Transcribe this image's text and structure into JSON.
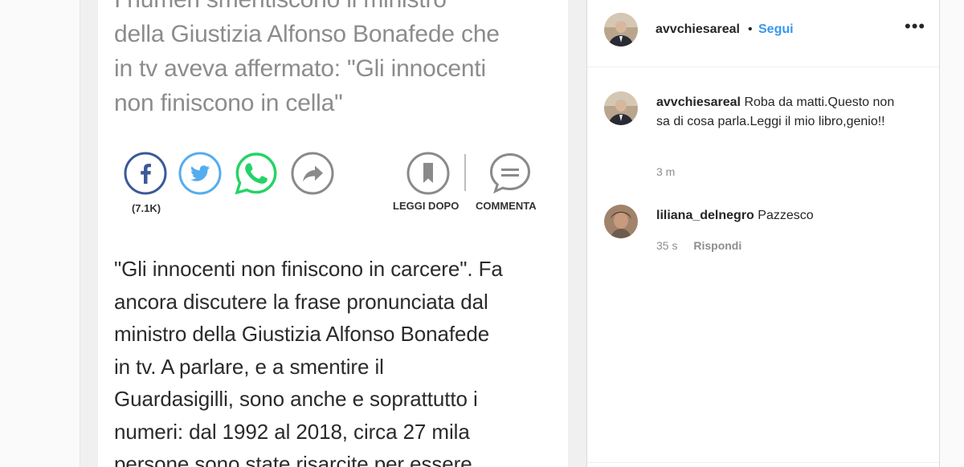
{
  "article": {
    "lead_line_1": "I numeri smentiscono il ministro",
    "lead_line_2": "della Giustizia Alfonso Bonafede che",
    "lead_line_3": "in tv aveva affermato: \"Gli innocenti",
    "lead_line_4": "non finiscono in cella\"",
    "share": {
      "facebook_count": "(7.1K)",
      "read_later_label": "LEGGI DOPO",
      "comment_label": "COMMENTA",
      "icons": [
        "facebook-icon",
        "twitter-icon",
        "whatsapp-icon",
        "share-icon",
        "bookmark-icon",
        "comment-icon"
      ]
    },
    "body_lines": [
      "\"Gli innocenti non finiscono in carcere\". Fa",
      "ancora discutere la frase pronunciata dal",
      "ministro della Giustizia Alfonso Bonafede",
      "in tv. A parlare, e a smentire il",
      "Guardasigilli, sono anche e soprattutto i",
      "numeri: dal 1992 al 2018, circa 27 mila",
      "persone sono state risarcite per essere"
    ]
  },
  "post": {
    "author": "avvchiesareal",
    "separator": "•",
    "follow_label": "Segui",
    "more_label": "•••"
  },
  "comments": [
    {
      "user": "avvchiesareal",
      "text": "Roba da matti.Questo non sa di cosa parla.Leggi il mio libro,genio!!",
      "time": "3 m"
    },
    {
      "user": "liliana_delnegro",
      "text": "Pazzesco",
      "time": "35 s",
      "reply_label": "Rispondi"
    }
  ],
  "colors": {
    "link_blue": "#3897f0",
    "facebook": "#3b5998",
    "twitter": "#55acee",
    "whatsapp": "#25d366",
    "grey_icon": "#8a8a8a"
  }
}
